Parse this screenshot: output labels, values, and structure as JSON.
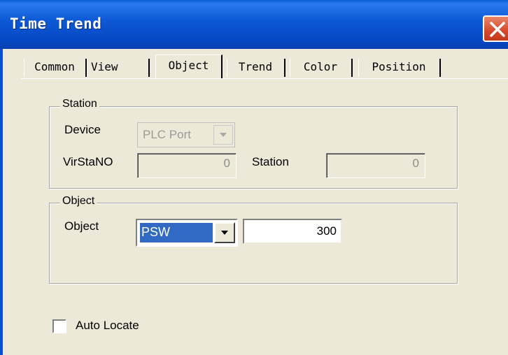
{
  "window": {
    "title": "Time Trend"
  },
  "tabs": [
    {
      "label": "Common"
    },
    {
      "label": "View"
    },
    {
      "label": "Object"
    },
    {
      "label": "Trend"
    },
    {
      "label": "Color"
    },
    {
      "label": "Position"
    }
  ],
  "active_tab": "Object",
  "station_group": {
    "legend": "Station",
    "device_label": "Device",
    "device_value": "PLC Port",
    "virstano_label": "VirStaNO",
    "virstano_value": "0",
    "station_label": "Station",
    "station_value": "0"
  },
  "object_group": {
    "legend": "Object",
    "object_label": "Object",
    "object_type": "PSW",
    "object_address": "300"
  },
  "auto_locate": {
    "label": "Auto Locate",
    "checked": false
  },
  "colors": {
    "titlebar": "#0646c2",
    "selection": "#316ac5",
    "dialog": "#ece9d8"
  }
}
